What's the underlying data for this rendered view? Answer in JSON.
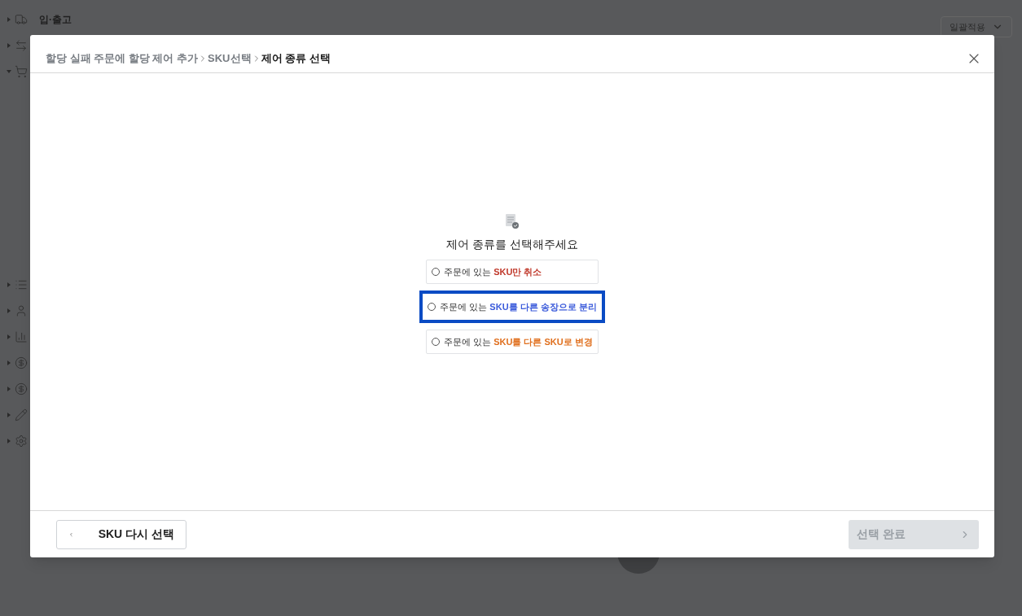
{
  "background": {
    "sidebar": [
      {
        "label": "입·출고",
        "expanded": false
      },
      {
        "expanded": false
      },
      {
        "expanded": true
      },
      {
        "expanded": false
      },
      {
        "expanded": false
      },
      {
        "expanded": false
      },
      {
        "expanded": false
      },
      {
        "expanded": false
      },
      {
        "expanded": false
      },
      {
        "expanded": false
      }
    ],
    "dropdown": {
      "value": "일괄적용"
    }
  },
  "dialog": {
    "breadcrumb": [
      {
        "label": "할당 실패 주문에 할당 제어 추가",
        "current": false
      },
      {
        "label": "SKU선택",
        "current": false
      },
      {
        "label": "제어 종류 선택",
        "current": true
      }
    ],
    "prompt": "제어 종류를 선택해주세요",
    "options": [
      {
        "prefix": "주문에 있는 ",
        "highlight": "SKU만 취소",
        "color": "#c0392b",
        "checked": false,
        "highlighted": false
      },
      {
        "prefix": "주문에 있는 ",
        "highlight": "SKU를 다른 송장으로 분리",
        "color": "#3b5bdb",
        "checked": false,
        "highlighted": true
      },
      {
        "prefix": "주문에 있는 ",
        "highlight": "SKU를 다른 SKU로 변경",
        "color": "#e0701f",
        "checked": false,
        "highlighted": false
      }
    ],
    "back_button": {
      "label": "SKU 다시 선택"
    },
    "next_button": {
      "label": "선택 완료",
      "disabled": true
    }
  }
}
